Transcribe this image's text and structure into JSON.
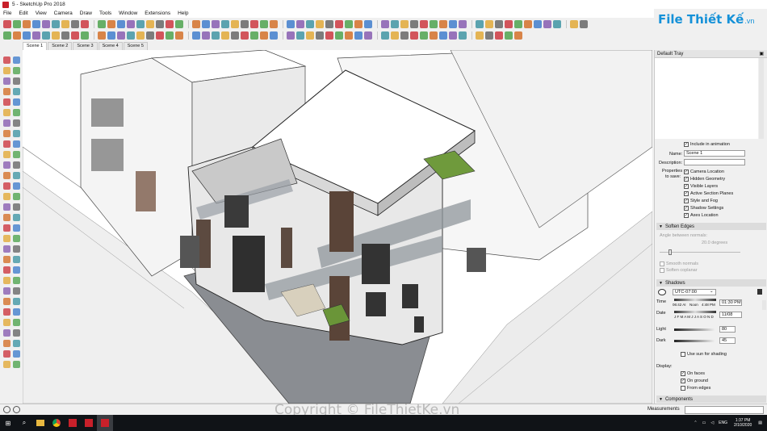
{
  "window": {
    "title": "5 - SketchUp Pro 2018"
  },
  "menu": [
    "File",
    "Edit",
    "View",
    "Camera",
    "Draw",
    "Tools",
    "Window",
    "Extensions",
    "Help"
  ],
  "scenes": [
    "Scene 1",
    "Scene 2",
    "Scene 3",
    "Scene 4",
    "Scene 5"
  ],
  "tray": {
    "title": "Default Tray",
    "include_in_animation": "Include in animation",
    "name_label": "Name:",
    "name_value": "Scene 1",
    "description_label": "Description:",
    "description_value": "",
    "properties_label_1": "Properties",
    "properties_label_2": "to save:",
    "properties": [
      "Camera Location",
      "Hidden Geometry",
      "Visible Layers",
      "Active Section Planes",
      "Style and Fog",
      "Shadow Settings",
      "Axes Location"
    ],
    "soften_edges": {
      "title": "Soften Edges",
      "angle_label": "Angle between normals:",
      "angle_value": "20.0  degrees",
      "smooth_normals": "Smooth normals",
      "soften_coplanar": "Soften coplanar"
    },
    "shadows": {
      "title": "Shadows",
      "timezone": "UTC-07:00",
      "time_label": "Time",
      "time_start": "06:42 AI",
      "time_mid": "Noon",
      "time_end": "4:48 PM",
      "time_value": "01:30 PM",
      "date_label": "Date",
      "months": "J F M A M J J A S O N D",
      "date_value": "11/08",
      "light_label": "Light",
      "light_value": "80",
      "dark_label": "Dark",
      "dark_value": "45",
      "use_sun": "Use sun for shading",
      "display_label": "Display:",
      "on_faces": "On faces",
      "on_ground": "On ground",
      "from_edges": "From edges"
    },
    "components_title": "Components"
  },
  "status": {
    "measurements_label": "Measurements"
  },
  "taskbar": {
    "time": "1:37 PM",
    "date": "2/10/2020",
    "lang": "ENG"
  },
  "logo": {
    "part1": "File Thiết Kế",
    "part2": ".vn"
  },
  "watermark": "Copyright © FileThietKe.vn",
  "colors": {
    "accent": "#1591d8",
    "taskbar": "#101317",
    "sketchup_red": "#c8202a"
  }
}
